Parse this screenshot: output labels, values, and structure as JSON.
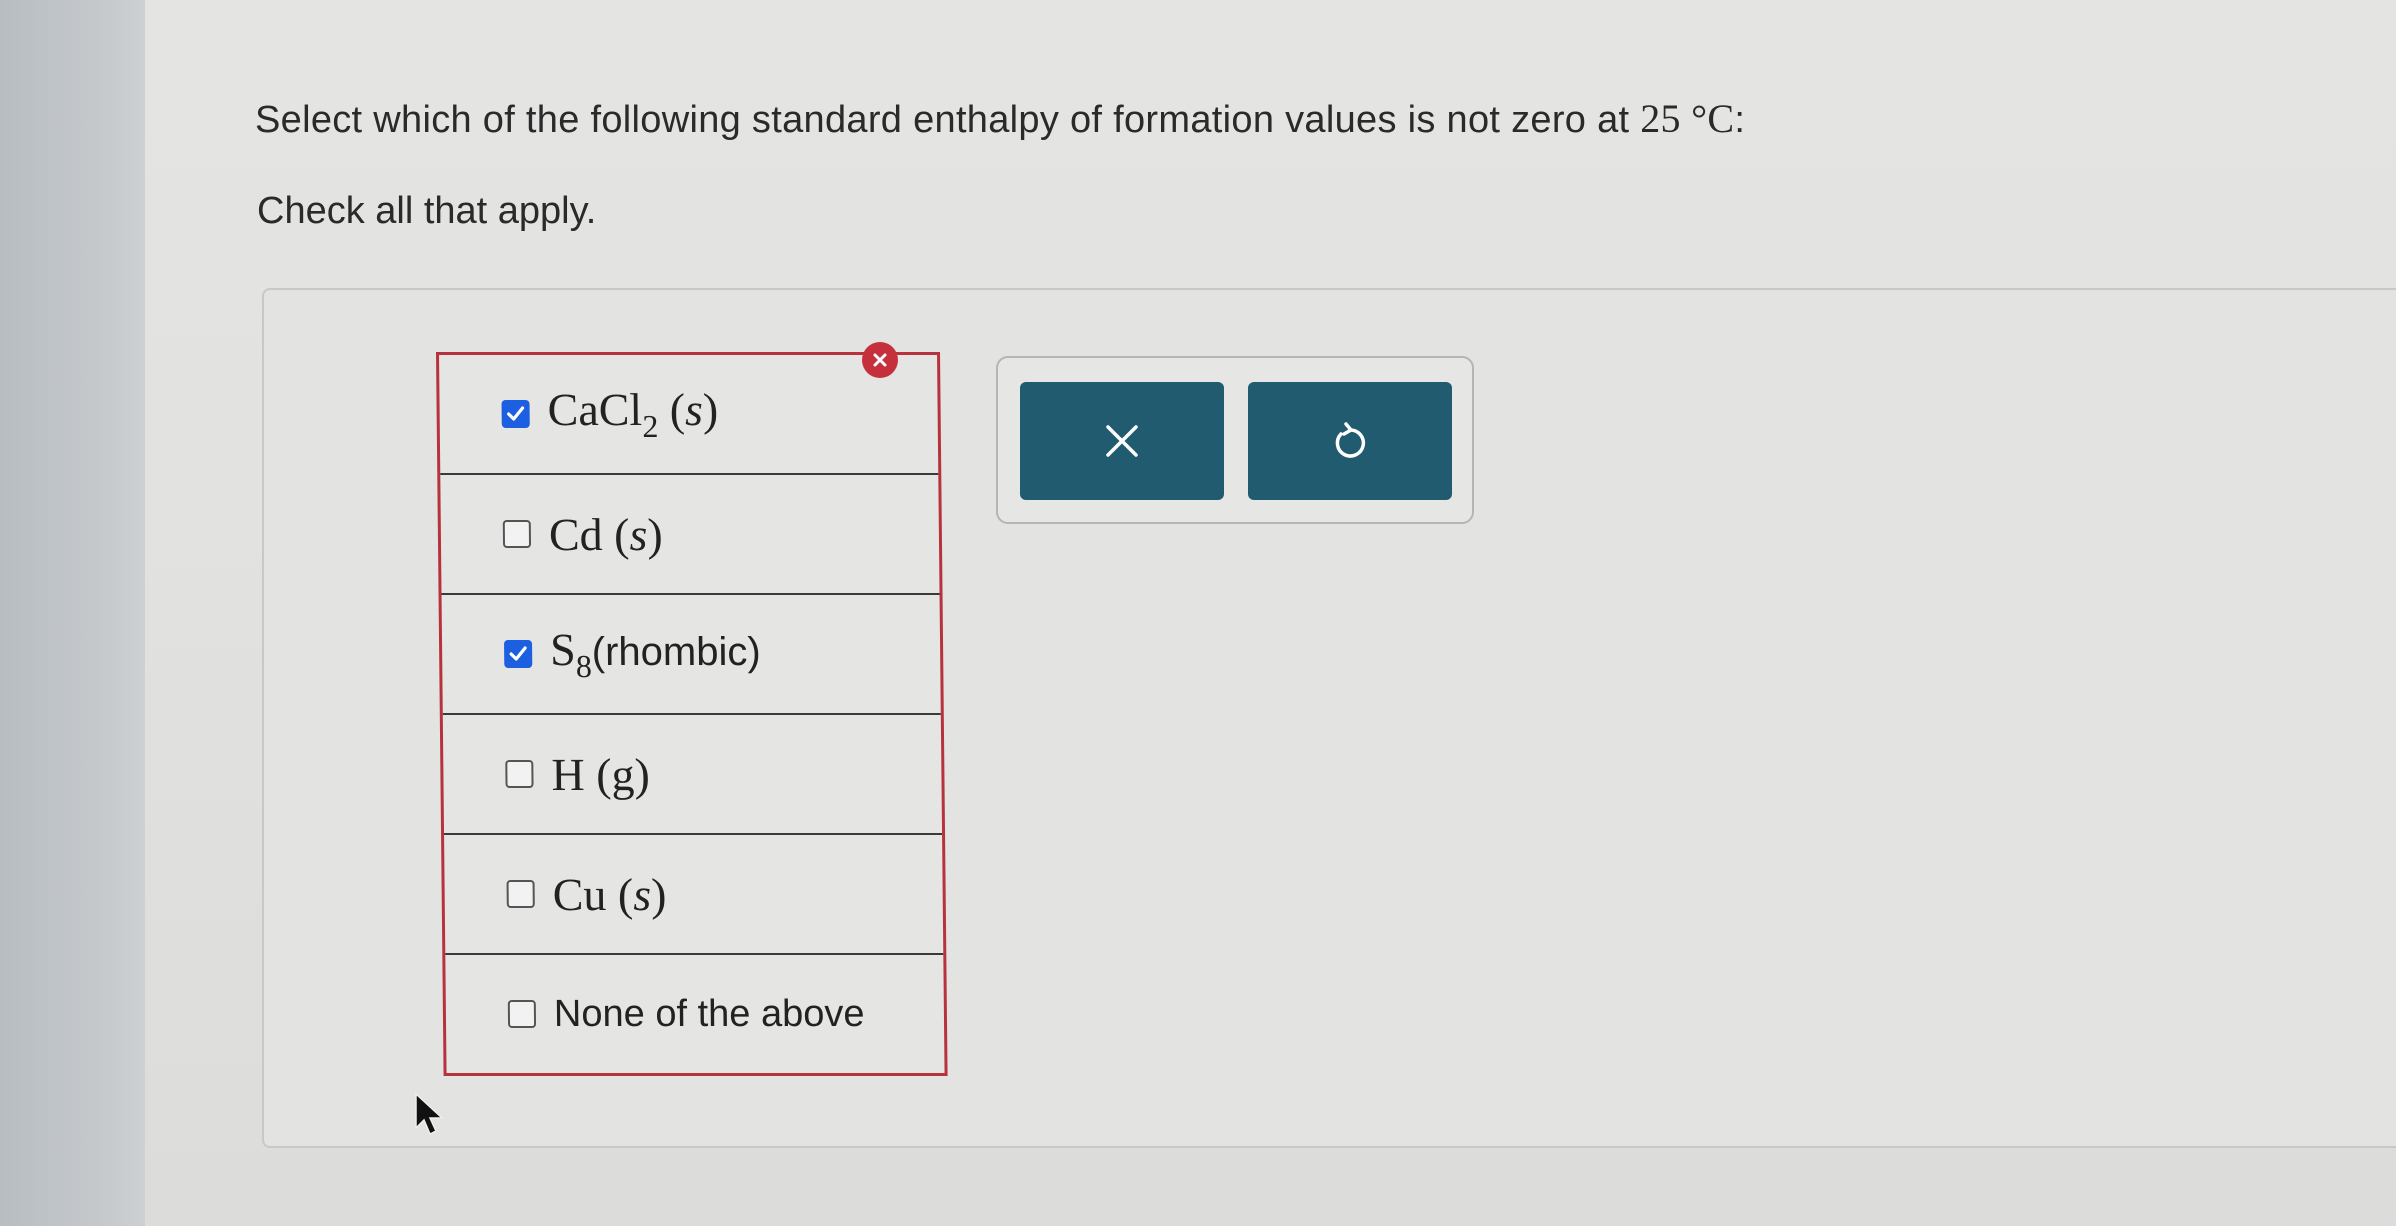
{
  "question": {
    "text_prefix": "Select which of the following standard enthalpy of formation values is not zero at ",
    "temperature": "25 °C",
    "text_suffix": ":"
  },
  "instruction": "Check all that apply.",
  "choices": [
    {
      "formula": "CaCl",
      "subscript": "2",
      "phase": "s",
      "checked": true
    },
    {
      "formula": "Cd",
      "subscript": "",
      "phase": "s",
      "checked": false
    },
    {
      "formula": "S",
      "subscript": "8",
      "phase": "rhombic",
      "checked": true
    },
    {
      "formula": "H",
      "subscript": "",
      "phase": "g",
      "checked": false
    },
    {
      "formula": "Cu",
      "subscript": "",
      "phase": "s",
      "checked": false
    },
    {
      "label": "None of the above",
      "checked": false
    }
  ],
  "toolbar": {
    "clear_icon": "x-icon",
    "undo_icon": "undo-icon"
  },
  "colors": {
    "error_border": "#b8323e",
    "checkbox_checked": "#1c5fe0",
    "button_bg": "#205b70"
  }
}
